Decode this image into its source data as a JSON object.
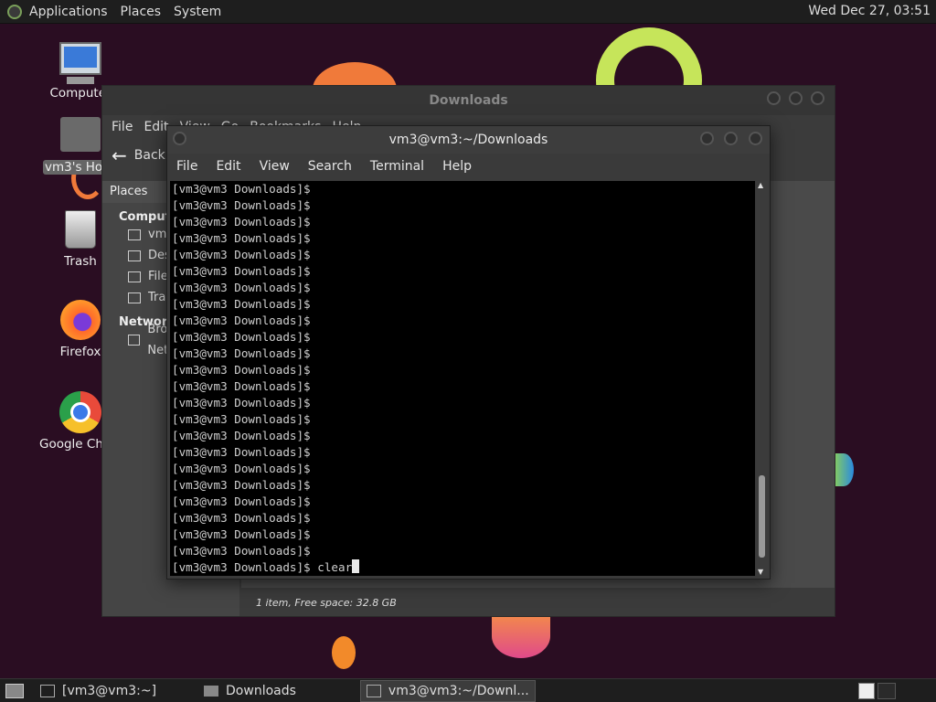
{
  "top_panel": {
    "menus": [
      "Applications",
      "Places",
      "System"
    ],
    "clock": "Wed Dec 27, 03:51"
  },
  "desktop_icons": [
    {
      "label": "Computer",
      "icon": "computer-icon"
    },
    {
      "label": "vm3's Home",
      "icon": "home-folder-icon"
    },
    {
      "label": "Trash",
      "icon": "trash-icon"
    },
    {
      "label": "Firefox",
      "icon": "firefox-icon"
    },
    {
      "label": "Google Chrome",
      "icon": "chrome-icon"
    }
  ],
  "file_manager": {
    "title": "Downloads",
    "menus": [
      "File",
      "Edit",
      "View",
      "Go",
      "Bookmarks",
      "Help"
    ],
    "back_label": "Back",
    "sidebar_header": "Places",
    "sections": [
      {
        "title": "Computer",
        "items": [
          {
            "label": "vm3",
            "icon": "home-icon"
          },
          {
            "label": "Desktop",
            "icon": "desktop-icon"
          },
          {
            "label": "File System",
            "icon": "drive-icon"
          },
          {
            "label": "Trash",
            "icon": "trash-icon"
          }
        ]
      },
      {
        "title": "Network",
        "items": [
          {
            "label": "Browse Network",
            "icon": "network-icon"
          }
        ]
      }
    ],
    "status": "1 item, Free space: 32.8 GB"
  },
  "terminal": {
    "title": "vm3@vm3:~/Downloads",
    "menus": [
      "File",
      "Edit",
      "View",
      "Search",
      "Terminal",
      "Help"
    ],
    "prompt": "[vm3@vm3 Downloads]$",
    "empty_prompt_lines": 23,
    "current_command": "clear"
  },
  "taskbar": {
    "tasks": [
      {
        "label": "[vm3@vm3:~]",
        "icon": "terminal-icon",
        "active": false
      },
      {
        "label": "Downloads",
        "icon": "folder-icon",
        "active": false
      },
      {
        "label": "vm3@vm3:~/Downl...",
        "icon": "terminal-icon",
        "active": true
      }
    ]
  },
  "colors": {
    "desktop_bg": "#2a0d22",
    "terminal_bg": "#000000",
    "terminal_fg": "#cfcfcf",
    "panel_bg": "#1e1e1e"
  }
}
